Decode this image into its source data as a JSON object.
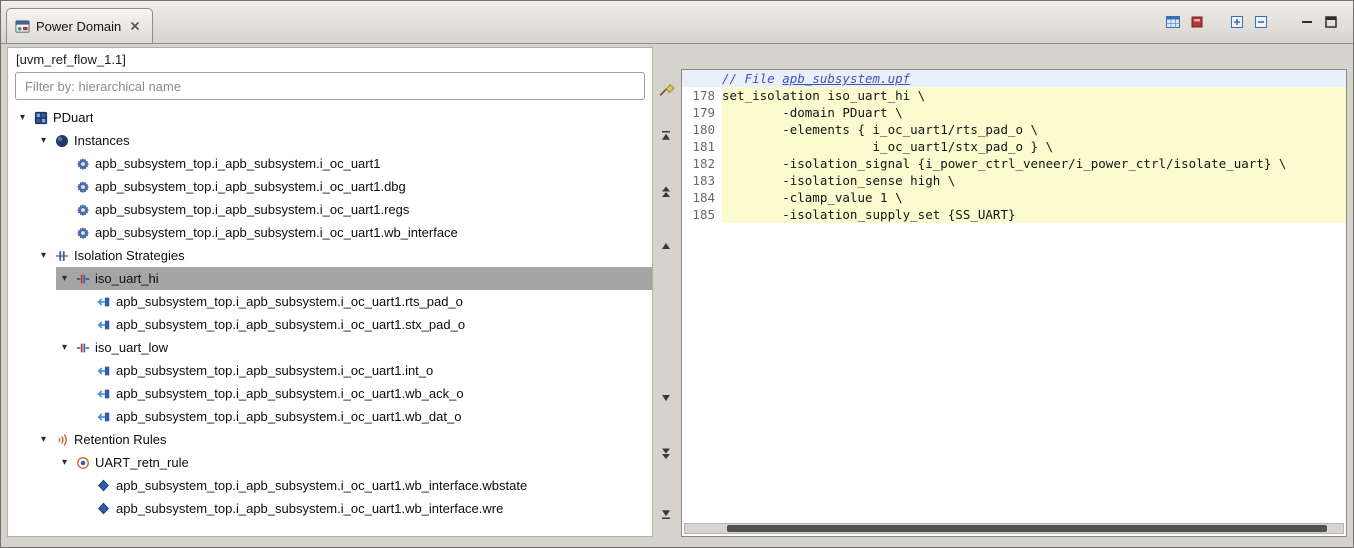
{
  "tab": {
    "title": "Power Domain"
  },
  "view_toolbar": {
    "buttons": [
      "show-table",
      "clear-highlight",
      "expand-box",
      "collapse-box",
      "minimize-view",
      "maximize-view"
    ]
  },
  "scope_label": "[uvm_ref_flow_1.1]",
  "filter": {
    "placeholder": "Filter by: hierarchical name"
  },
  "nav_strip": {
    "clear_filter_icon": "broom",
    "buttons": [
      "go-to-first",
      "previous-group",
      "previous",
      "next",
      "next-group",
      "go-to-last"
    ]
  },
  "tree": {
    "items": [
      {
        "label": "PDuart",
        "level": 0,
        "icon": "power-domain",
        "expanded": true
      },
      {
        "label": "Instances",
        "level": 1,
        "icon": "instances",
        "expanded": true
      },
      {
        "label": "apb_subsystem_top.i_apb_subsystem.i_oc_uart1",
        "level": 2,
        "icon": "instance"
      },
      {
        "label": "apb_subsystem_top.i_apb_subsystem.i_oc_uart1.dbg",
        "level": 2,
        "icon": "instance"
      },
      {
        "label": "apb_subsystem_top.i_apb_subsystem.i_oc_uart1.regs",
        "level": 2,
        "icon": "instance"
      },
      {
        "label": "apb_subsystem_top.i_apb_subsystem.i_oc_uart1.wb_interface",
        "level": 2,
        "icon": "instance"
      },
      {
        "label": "Isolation Strategies",
        "level": 1,
        "icon": "isolation-strategies",
        "expanded": true
      },
      {
        "label": "iso_uart_hi",
        "level": 2,
        "icon": "isolation-strategy",
        "expanded": true,
        "selected": true
      },
      {
        "label": "apb_subsystem_top.i_apb_subsystem.i_oc_uart1.rts_pad_o",
        "level": 3,
        "icon": "port"
      },
      {
        "label": "apb_subsystem_top.i_apb_subsystem.i_oc_uart1.stx_pad_o",
        "level": 3,
        "icon": "port"
      },
      {
        "label": "iso_uart_low",
        "level": 2,
        "icon": "isolation-strategy",
        "expanded": true
      },
      {
        "label": "apb_subsystem_top.i_apb_subsystem.i_oc_uart1.int_o",
        "level": 3,
        "icon": "port"
      },
      {
        "label": "apb_subsystem_top.i_apb_subsystem.i_oc_uart1.wb_ack_o",
        "level": 3,
        "icon": "port"
      },
      {
        "label": "apb_subsystem_top.i_apb_subsystem.i_oc_uart1.wb_dat_o",
        "level": 3,
        "icon": "port"
      },
      {
        "label": "Retention Rules",
        "level": 1,
        "icon": "retention-rules",
        "expanded": true
      },
      {
        "label": "UART_retn_rule",
        "level": 2,
        "icon": "retention-rule",
        "expanded": true
      },
      {
        "label": "apb_subsystem_top.i_apb_subsystem.i_oc_uart1.wb_interface.wbstate",
        "level": 3,
        "icon": "retention-element"
      },
      {
        "label": "apb_subsystem_top.i_apb_subsystem.i_oc_uart1.wb_interface.wre",
        "level": 3,
        "icon": "retention-element"
      }
    ]
  },
  "code": {
    "header_comment": {
      "prefix": "// File ",
      "filename": "apb_subsystem.upf"
    },
    "lines": [
      {
        "num": "178",
        "text": "set_isolation iso_uart_hi \\"
      },
      {
        "num": "179",
        "text": "        -domain PDuart \\"
      },
      {
        "num": "180",
        "text": "        -elements { i_oc_uart1/rts_pad_o \\"
      },
      {
        "num": "181",
        "text": "                    i_oc_uart1/stx_pad_o } \\"
      },
      {
        "num": "182",
        "text": "        -isolation_signal {i_power_ctrl_veneer/i_power_ctrl/isolate_uart} \\"
      },
      {
        "num": "183",
        "text": "        -isolation_sense high \\"
      },
      {
        "num": "184",
        "text": "        -clamp_value 1 \\"
      },
      {
        "num": "185",
        "text": "        -isolation_supply_set {SS_UART}"
      }
    ]
  },
  "colors": {
    "highlight_yellow": "#fbfbd0",
    "selection_gray": "#a5a5a5",
    "comment_blue": "#4651b8",
    "header_line_blue": "#e9effb"
  }
}
